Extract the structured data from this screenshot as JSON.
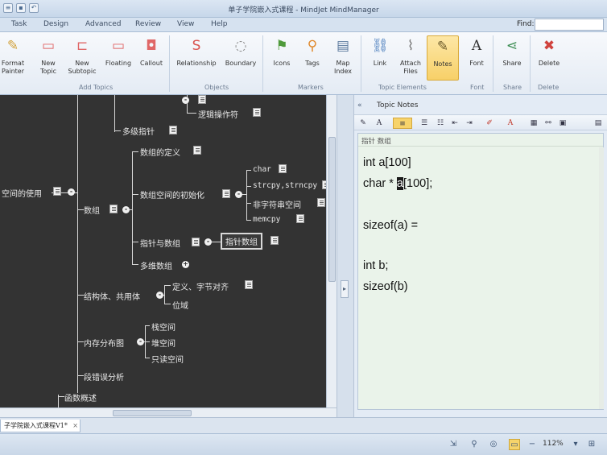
{
  "window": {
    "title": "单子学院嵌入式课程 - MindJet MindManager"
  },
  "ribbon_tabs": [
    "Task",
    "Design",
    "Advanced",
    "Review",
    "View",
    "Help"
  ],
  "find_label": "Find:",
  "ribbon": {
    "buttons": [
      {
        "label": "Format\nPainter",
        "icon": "format-painter-icon"
      },
      {
        "label": "New\nTopic",
        "icon": "new-topic-icon"
      },
      {
        "label": "New\nSubtopic",
        "icon": "new-subtopic-icon"
      },
      {
        "label": "Floating",
        "icon": "floating-topic-icon"
      },
      {
        "label": "Callout",
        "icon": "callout-icon"
      },
      {
        "label": "Relationship",
        "icon": "relationship-icon"
      },
      {
        "label": "Boundary",
        "icon": "boundary-icon"
      },
      {
        "label": "Icons",
        "icon": "icons-icon"
      },
      {
        "label": "Tags",
        "icon": "tags-icon"
      },
      {
        "label": "Map\nIndex",
        "icon": "map-index-icon"
      },
      {
        "label": "Link",
        "icon": "link-icon"
      },
      {
        "label": "Attach\nFiles",
        "icon": "attach-icon"
      },
      {
        "label": "Notes",
        "icon": "notes-icon"
      },
      {
        "label": "Font",
        "icon": "font-icon"
      },
      {
        "label": "Share",
        "icon": "share-icon"
      },
      {
        "label": "Delete",
        "icon": "delete-icon"
      }
    ],
    "groups": [
      "Add Topics",
      "Objects",
      "Markers",
      "Topic Elements",
      "Font",
      "Share",
      "Delete"
    ]
  },
  "map": {
    "nodes": {
      "n_top1": "逻辑操作符",
      "n_multiptr": "多级指针",
      "n_central": "空间的使用",
      "n_array": "数组",
      "n_arraydef": "数组的定义",
      "n_arrayinit": "数组空间的初始化",
      "n_char": "char",
      "n_strcpy": "strcpy,strncpy",
      "n_nonstr": "非字符串空间",
      "n_memcpy": "memcpy",
      "n_ptrarr": "指针与数组",
      "n_ptrarr_child": "指针数组",
      "n_multiarr": "多维数组",
      "n_struct": "结构体、共用体",
      "n_align": "定义、字节对齐",
      "n_bitfield": "位域",
      "n_memlayout": "内存分布图",
      "n_stack": "栈空间",
      "n_heap": "堆空间",
      "n_ro": "只读空间",
      "n_segfault": "段错误分析",
      "n_funcs": "函数概述"
    }
  },
  "notes_pane": {
    "title": "Topic Notes",
    "collapse": "«",
    "header": "指针 数组",
    "lines": [
      "int a[100]",
      "char * ",
      "a",
      "[100];",
      "sizeof(a) =",
      "int b;",
      "sizeof(b)"
    ]
  },
  "doc_tab": {
    "label": "子学院嵌入式课程V1*",
    "close": "×"
  },
  "status": {
    "zoom": "112%"
  }
}
